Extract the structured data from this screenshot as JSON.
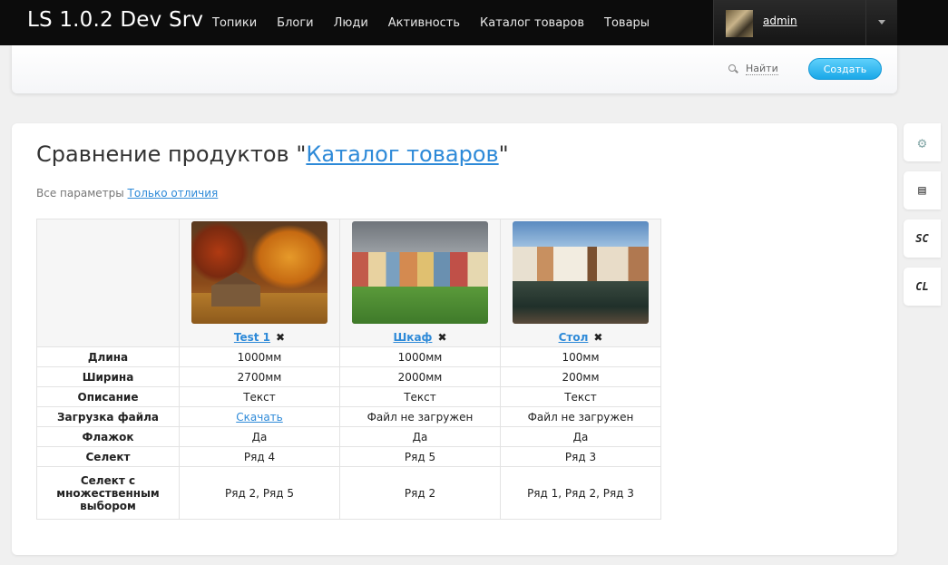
{
  "app": {
    "title": "LS 1.0.2 Dev Srv"
  },
  "nav": {
    "items": [
      {
        "label": "Топики"
      },
      {
        "label": "Блоги"
      },
      {
        "label": "Люди"
      },
      {
        "label": "Активность"
      },
      {
        "label": "Каталог товаров"
      },
      {
        "label": "Товары"
      }
    ]
  },
  "user": {
    "name": "admin"
  },
  "subheader": {
    "search_label": "Найти",
    "create_label": "Создать"
  },
  "page": {
    "title_prefix": "Сравнение продуктов \"",
    "title_link": "Каталог товаров",
    "title_suffix": "\"",
    "filter_all": "Все параметры",
    "filter_diff": "Только отличия"
  },
  "products": [
    {
      "name": "Test 1"
    },
    {
      "name": "Шкаф"
    },
    {
      "name": "Стол"
    }
  ],
  "comparison": {
    "rows": [
      {
        "label": "Длина",
        "values": [
          "1000мм",
          "1000мм",
          "100мм"
        ]
      },
      {
        "label": "Ширина",
        "values": [
          "2700мм",
          "2000мм",
          "200мм"
        ]
      },
      {
        "label": "Описание",
        "values": [
          "Текст",
          "Текст",
          "Текст"
        ]
      },
      {
        "label": "Загрузка файла",
        "values": [
          "Скачать",
          "Файл не загружен",
          "Файл не загружен"
        ]
      },
      {
        "label": "Флажок",
        "values": [
          "Да",
          "Да",
          "Да"
        ]
      },
      {
        "label": "Селект",
        "values": [
          "Ряд 4",
          "Ряд 5",
          "Ряд 3"
        ]
      },
      {
        "label": "Селект с множественным выбором",
        "values": [
          "Ряд 2, Ряд 5",
          "Ряд 2",
          "Ряд 1, Ряд 2, Ряд 3"
        ]
      }
    ]
  },
  "side_tools": {
    "sc": "SC",
    "cl": "CL"
  },
  "icons": {
    "remove": "close-icon",
    "search": "search-icon",
    "settings": "gear-icon",
    "list": "list-icon"
  }
}
